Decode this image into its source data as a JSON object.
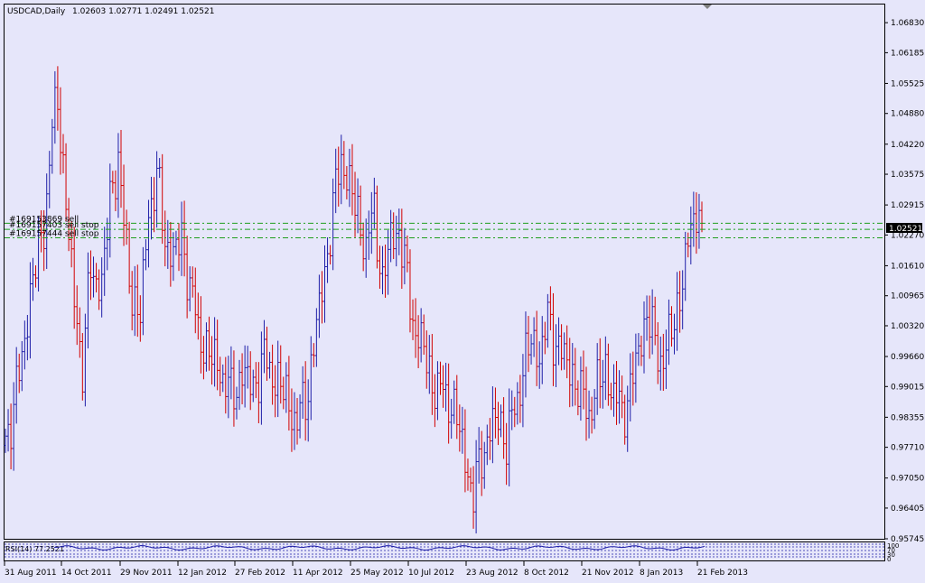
{
  "header": {
    "symbol_tf": "USDCAD,Daily",
    "ohlc": "1.02603 1.02771 1.02491 1.02521"
  },
  "orders": [
    {
      "label": "#169153869 sell",
      "price": 1.02521
    },
    {
      "label": "#169157403 sell stop",
      "price": 1.0239
    },
    {
      "label": "#169157444 sell stop",
      "price": 1.0221
    }
  ],
  "current_price_label": "1.02521",
  "indicator": {
    "label": "RSI(14) 77.2521",
    "levels": [
      "100",
      "70",
      "30",
      "0"
    ],
    "value": 77.2521
  },
  "colors": {
    "background": "#e6e6fa",
    "bull_bar": "#1f1fa8",
    "bear_bar": "#d10000",
    "order_line": "#1e9e1e",
    "frame": "#000000",
    "indicator_line": "#1f1fa8"
  },
  "chart_data": {
    "type": "bar",
    "instrument": "USDCAD",
    "timeframe": "Daily",
    "y_ticks": [
      "1.06830",
      "1.06185",
      "1.05525",
      "1.04880",
      "1.04220",
      "1.03575",
      "1.02915",
      "1.02270",
      "1.01610",
      "1.00965",
      "1.00320",
      "0.99660",
      "0.99015",
      "0.98355",
      "0.97710",
      "0.97050",
      "0.96405",
      "0.95745"
    ],
    "ylim": [
      0.95745,
      1.0722
    ],
    "x_ticks": [
      "31 Aug 2011",
      "14 Oct 2011",
      "29 Nov 2011",
      "12 Jan 2012",
      "27 Feb 2012",
      "11 Apr 2012",
      "25 May 2012",
      "10 Jul 2012",
      "23 Aug 2012",
      "8 Oct 2012",
      "21 Nov 2012",
      "8 Jan 2013",
      "21 Feb 2013"
    ],
    "close_path": [
      [
        0,
        0.978
      ],
      [
        5,
        0.992
      ],
      [
        9,
        1.01
      ],
      [
        14,
        1.025
      ],
      [
        17,
        1.045
      ],
      [
        19,
        1.052
      ],
      [
        22,
        1.03
      ],
      [
        25,
        1.008
      ],
      [
        28,
        0.995
      ],
      [
        31,
        1.015
      ],
      [
        35,
        1.012
      ],
      [
        38,
        1.03
      ],
      [
        41,
        1.04
      ],
      [
        43,
        1.024
      ],
      [
        46,
        1.01
      ],
      [
        49,
        1.005
      ],
      [
        52,
        1.028
      ],
      [
        55,
        1.035
      ],
      [
        58,
        1.022
      ],
      [
        61,
        1.018
      ],
      [
        64,
        1.022
      ],
      [
        67,
        1.012
      ],
      [
        70,
        1.002
      ],
      [
        74,
        0.997
      ],
      [
        78,
        0.994
      ],
      [
        82,
        0.988
      ],
      [
        86,
        0.993
      ],
      [
        90,
        0.99
      ],
      [
        94,
        0.996
      ],
      [
        98,
        0.992
      ],
      [
        102,
        0.988
      ],
      [
        106,
        0.982
      ],
      [
        110,
        0.99
      ],
      [
        113,
        1.003
      ],
      [
        116,
        1.015
      ],
      [
        119,
        1.028
      ],
      [
        122,
        1.04
      ],
      [
        125,
        1.033
      ],
      [
        128,
        1.027
      ],
      [
        131,
        1.02
      ],
      [
        134,
        1.028
      ],
      [
        137,
        1.012
      ],
      [
        140,
        1.022
      ],
      [
        143,
        1.024
      ],
      [
        146,
        1.012
      ],
      [
        149,
        1.002
      ],
      [
        152,
        0.998
      ],
      [
        155,
        0.991
      ],
      [
        158,
        0.989
      ],
      [
        161,
        0.988
      ],
      [
        164,
        0.983
      ],
      [
        167,
        0.975
      ],
      [
        170,
        0.966
      ],
      [
        173,
        0.976
      ],
      [
        176,
        0.98
      ],
      [
        179,
        0.984
      ],
      [
        182,
        0.978
      ],
      [
        185,
        0.985
      ],
      [
        188,
        0.994
      ],
      [
        191,
        1.0
      ],
      [
        194,
        0.997
      ],
      [
        197,
        1.004
      ],
      [
        200,
        1.0
      ],
      [
        203,
        0.996
      ],
      [
        206,
        0.993
      ],
      [
        209,
        0.988
      ],
      [
        212,
        0.985
      ],
      [
        215,
        0.99
      ],
      [
        218,
        0.994
      ],
      [
        221,
        0.988
      ],
      [
        224,
        0.985
      ],
      [
        227,
        0.989
      ],
      [
        230,
        0.998
      ],
      [
        233,
        1.006
      ],
      [
        236,
        0.999
      ],
      [
        239,
        0.996
      ],
      [
        242,
        1.002
      ],
      [
        245,
        1.01
      ],
      [
        248,
        1.02
      ],
      [
        251,
        1.03
      ],
      [
        253,
        1.02521
      ]
    ]
  }
}
